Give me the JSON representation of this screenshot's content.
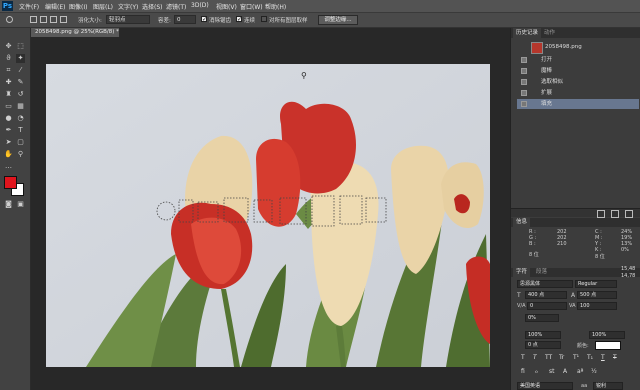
{
  "app": {
    "logo": "Ps"
  },
  "menu": [
    "文件(F)",
    "编辑(E)",
    "图像(I)",
    "图层(L)",
    "文字(Y)",
    "选择(S)",
    "滤镜(T)",
    "3D(D)",
    "视图(V)",
    "窗口(W)",
    "帮助(H)"
  ],
  "options": {
    "feather_label": "羽化大小:",
    "feather_value": "轻羽点",
    "tolerance_label": "容差:",
    "tolerance_value": "0",
    "antialias_label": "消除锯齿",
    "contiguous_label": "连续",
    "sample_all_label": "对所有图层取样",
    "refine_edge_label": "调整边缘..."
  },
  "document": {
    "tab_label": "2058498.png @ 25%(RGB/8) *"
  },
  "colors": {
    "foreground": "#e0141d",
    "background": "#ffffff",
    "accent": "#31a8ff"
  },
  "history": {
    "tab_history": "历史记录",
    "tab_actions": "动作",
    "snapshot_label": "2058498.png",
    "items": [
      "打开",
      "魔棒",
      "选取相似",
      "扩展",
      "填充"
    ],
    "active_index": 4
  },
  "info": {
    "tab": "信息",
    "r_label": "R :",
    "r_value": "202",
    "g_label": "G :",
    "g_value": "202",
    "b_label": "B :",
    "b_value": "210",
    "bit_left": "8 位",
    "c_label": "C :",
    "c_value": "24%",
    "m_label": "M :",
    "m_value": "19%",
    "y_label": "Y :",
    "y_value": "13%",
    "k_label": "K :",
    "k_value": "0%",
    "bit_right": "8 位"
  },
  "character": {
    "tab_char": "字符",
    "tab_para": "段落",
    "font_family": "思源黑体",
    "font_style": "Regular",
    "size": "400 点",
    "leading": "500 点",
    "kerning": "0",
    "tracking": "100",
    "scale_pct": "0%",
    "vscale": "100%",
    "hscale": "100%",
    "baseline": "0 点",
    "color_label": "颜色:",
    "lang": "美国英语",
    "aa": "锐利",
    "ruler_1": "15,48",
    "ruler_2": "14,78"
  }
}
